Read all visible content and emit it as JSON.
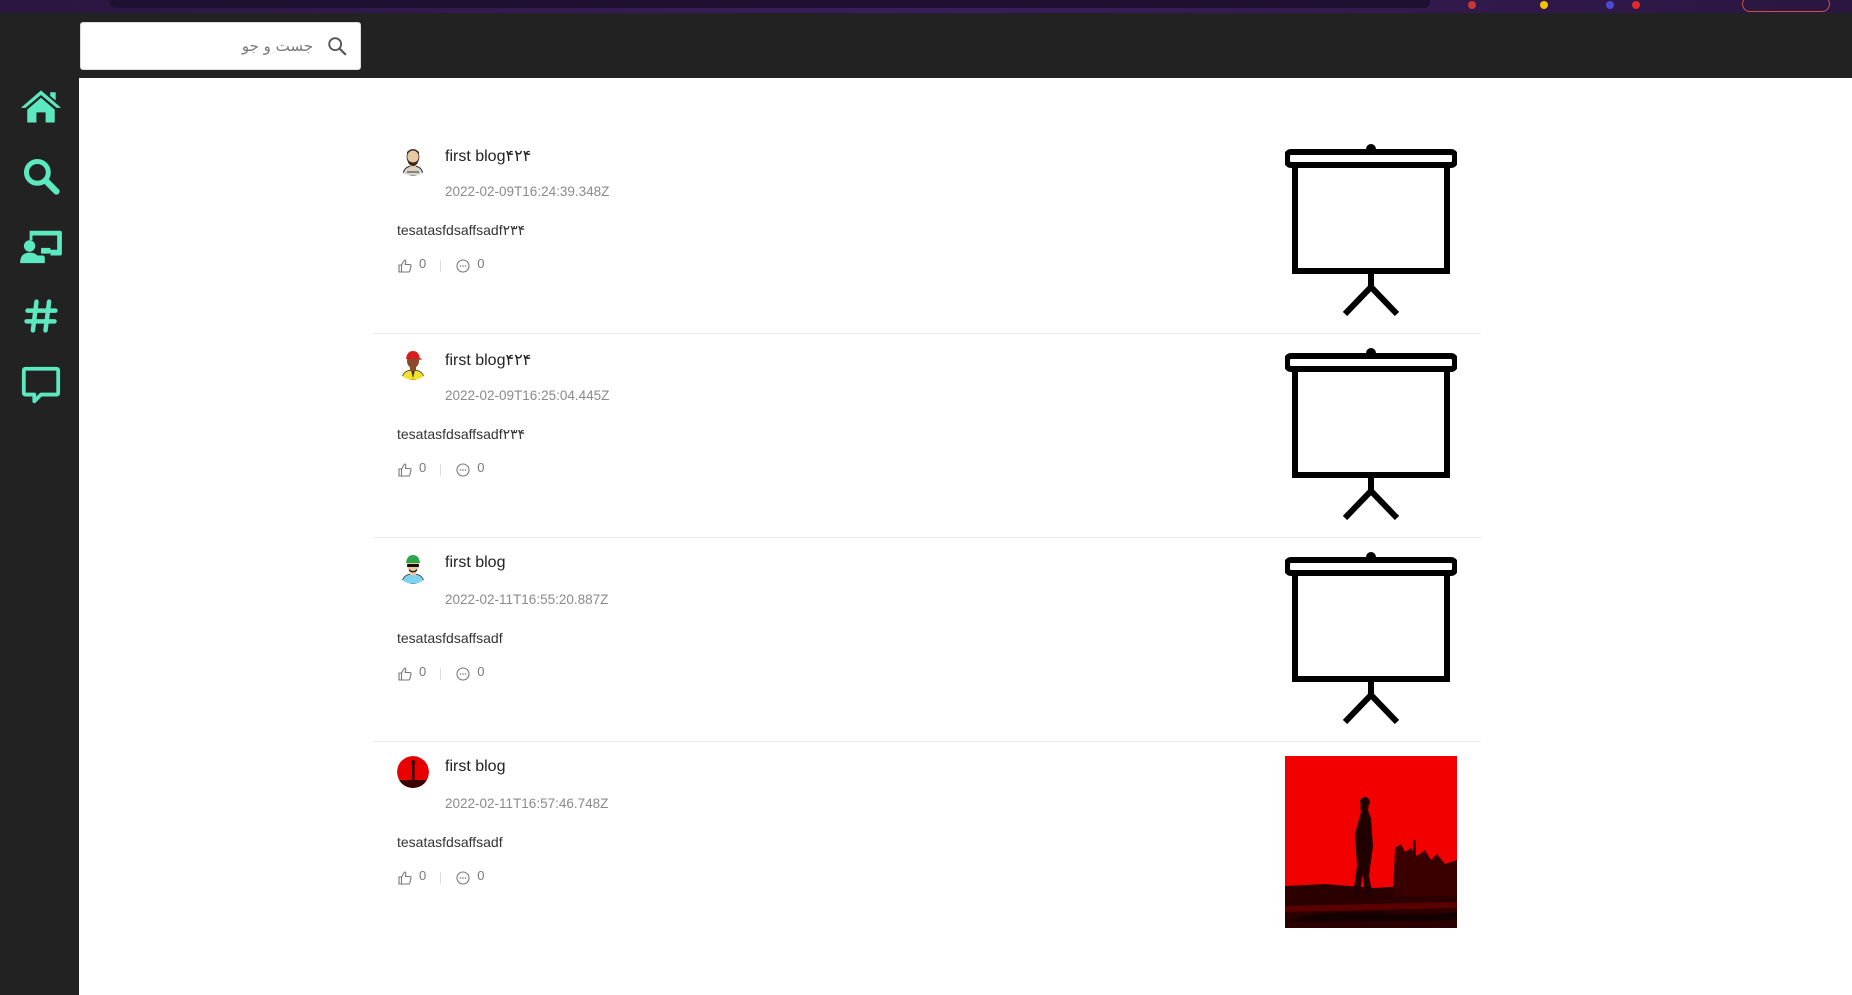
{
  "search": {
    "placeholder": "جست و جو",
    "icon": "search-icon"
  },
  "sidebar": {
    "accent_color": "#5ce8c0",
    "items": [
      {
        "name": "home",
        "icon": "home-icon"
      },
      {
        "name": "search",
        "icon": "search-icon"
      },
      {
        "name": "presenter",
        "icon": "presenter-icon"
      },
      {
        "name": "hashtag",
        "icon": "hashtag-icon"
      },
      {
        "name": "messages",
        "icon": "chat-icon"
      }
    ]
  },
  "posts": [
    {
      "title": "first blog۴۲۴",
      "date": "2022-02-09T16:24:39.348Z",
      "body": "tesatasfdsaffsadf۲۳۴",
      "likes": "0",
      "comments": "0",
      "avatar": "avatar-bearded-man",
      "image": "projector-screen-icon"
    },
    {
      "title": "first blog۴۲۴",
      "date": "2022-02-09T16:25:04.445Z",
      "body": "tesatasfdsaffsadf۲۳۴",
      "likes": "0",
      "comments": "0",
      "avatar": "avatar-red-cap-man",
      "image": "projector-screen-icon"
    },
    {
      "title": "first blog",
      "date": "2022-02-11T16:55:20.887Z",
      "body": "tesatasfdsaffsadf",
      "likes": "0",
      "comments": "0",
      "avatar": "avatar-green-cap-man",
      "image": "projector-screen-icon"
    },
    {
      "title": "first blog",
      "date": "2022-02-11T16:57:46.748Z",
      "body": "tesatasfdsaffsadf",
      "likes": "0",
      "comments": "0",
      "avatar": "avatar-red-silhouette",
      "image": "red-silhouette-photo"
    }
  ]
}
